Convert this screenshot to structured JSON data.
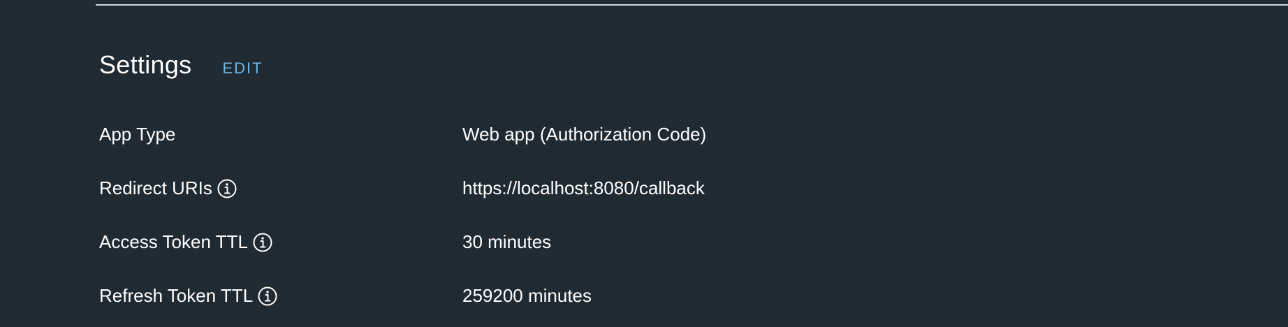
{
  "settings": {
    "title": "Settings",
    "edit_label": "EDIT",
    "rows": [
      {
        "label": "App Type",
        "value": "Web app (Authorization Code)",
        "has_info_icon": false
      },
      {
        "label": "Redirect URIs",
        "value": "https://localhost:8080/callback",
        "has_info_icon": true,
        "icon": "info-icon"
      },
      {
        "label": "Access Token TTL",
        "value": "30 minutes",
        "has_info_icon": true,
        "icon": "info-icon"
      },
      {
        "label": "Refresh Token TTL",
        "value": "259200 minutes",
        "has_info_icon": true,
        "icon": "info-icon"
      }
    ]
  },
  "colors": {
    "background": "#1f2a33",
    "text": "#ffffff",
    "link": "#6fb6e6",
    "divider": "#c9d2d8"
  }
}
